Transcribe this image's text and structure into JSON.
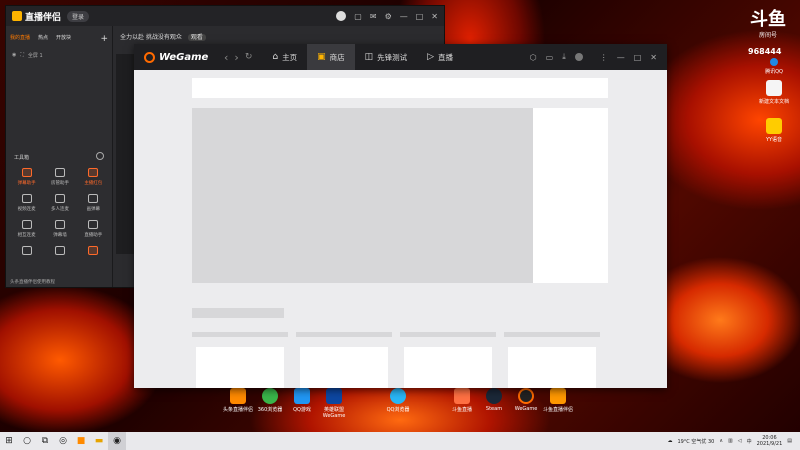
{
  "live_app": {
    "title": "直播伴侣",
    "login_label": "登录",
    "tabs": [
      "我的直播",
      "热点",
      "开放块"
    ],
    "scene_label": "全屏 1",
    "stream_title": "全力以赴 挑战没有观众",
    "tag_label": "观看",
    "tools_title": "工具箱",
    "tools": [
      {
        "label": "弹幕助手",
        "hot": true
      },
      {
        "label": "房管助手",
        "hot": false
      },
      {
        "label": "主播红包",
        "hot": true
      },
      {
        "label": "视频连麦",
        "hot": false
      },
      {
        "label": "多人连麦",
        "hot": false
      },
      {
        "label": "画弹幕",
        "hot": false
      },
      {
        "label": "相互连麦",
        "hot": false
      },
      {
        "label": "弹幕墙",
        "hot": false
      },
      {
        "label": "直播助手",
        "hot": false
      },
      {
        "label": "",
        "hot": false
      },
      {
        "label": "",
        "hot": false
      },
      {
        "label": "",
        "hot": true
      }
    ],
    "footer_text": "头条直播伴侣使用教程"
  },
  "wegame": {
    "logo": "WeGame",
    "tabs": [
      {
        "label": "主页",
        "icon": "home-icon",
        "glyph": "⌂",
        "active": false
      },
      {
        "label": "商店",
        "icon": "shop-bag-icon",
        "glyph": "▣",
        "active": true
      },
      {
        "label": "先锋测试",
        "icon": "test-icon",
        "glyph": "◫",
        "active": false
      },
      {
        "label": "直播",
        "icon": "play-icon",
        "glyph": "▷",
        "active": false
      }
    ]
  },
  "desktop": {
    "logo_text": "斗鱼",
    "room_label": "房间号",
    "room_number": "968444",
    "right_icons": [
      "腾讯QQ",
      "新建文本文档",
      "YY语音"
    ],
    "bottom_icons": [
      "头条直播伴侣",
      "360浏览器",
      "QQ游戏",
      "英雄联盟WeGame",
      "QQ浏览器",
      "斗鱼直播",
      "Steam",
      "WeGame",
      "斗鱼直播伴侣"
    ]
  },
  "taskbar": {
    "weather": "19°C 空气优 30",
    "time": "20:06",
    "date": "2021/9/21"
  }
}
